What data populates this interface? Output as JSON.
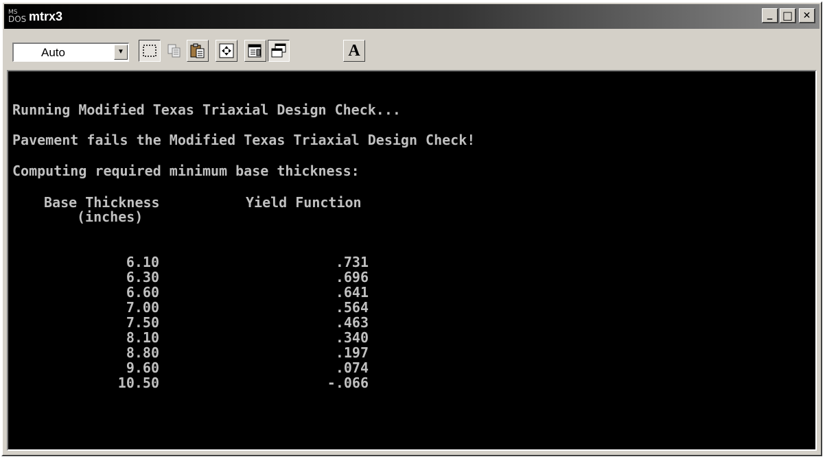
{
  "window": {
    "icon_line1": "MS",
    "icon_line2": "DOS",
    "title": "mtrx3",
    "minimize_glyph": "_",
    "maximize_glyph": "□",
    "close_glyph": "✕"
  },
  "toolbar": {
    "font_select_value": "Auto",
    "dropdown_glyph": "▼",
    "buttons": [
      "mark-icon",
      "copy-icon",
      "paste-icon",
      "full-screen-icon",
      "properties-icon",
      "background-icon",
      "font-icon"
    ],
    "font_button_label": "A"
  },
  "console": {
    "line1": "Running Modified Texas Triaxial Design Check...",
    "line2": "Pavement fails the Modified Texas Triaxial Design Check!",
    "line3": "Computing required minimum base thickness:",
    "header_col1": "Base Thickness",
    "header_col1_unit": "(inches)",
    "header_col2": "Yield Function",
    "rows": [
      {
        "thickness": "6.10",
        "yield": ".731"
      },
      {
        "thickness": "6.30",
        "yield": ".696"
      },
      {
        "thickness": "6.60",
        "yield": ".641"
      },
      {
        "thickness": "7.00",
        "yield": ".564"
      },
      {
        "thickness": "7.50",
        "yield": ".463"
      },
      {
        "thickness": "8.10",
        "yield": ".340"
      },
      {
        "thickness": "8.80",
        "yield": ".197"
      },
      {
        "thickness": "9.60",
        "yield": ".074"
      },
      {
        "thickness": "10.50",
        "yield": "-.066"
      }
    ]
  },
  "colors": {
    "console_background": "#000000",
    "console_text": "#c0c0c0",
    "chrome": "#d4d0c8"
  }
}
